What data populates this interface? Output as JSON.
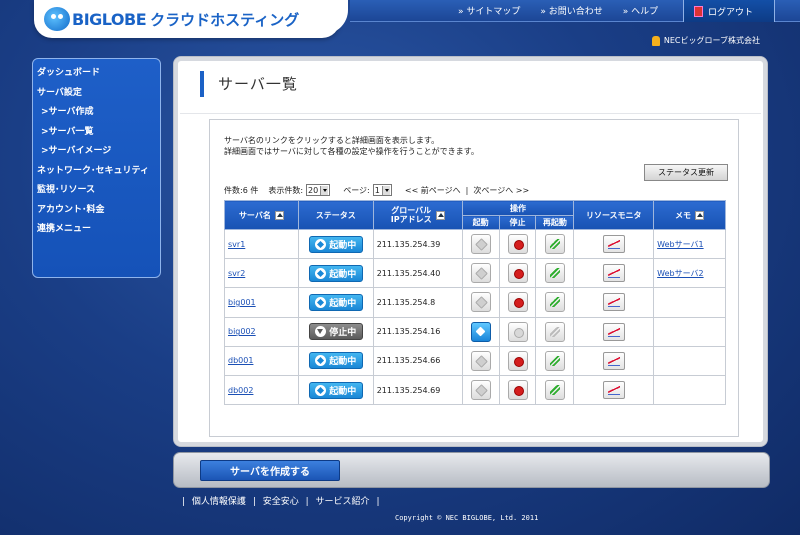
{
  "header": {
    "logo_text": "BIGLOBE",
    "logo_sub": "クラウドホスティング",
    "nav": [
      "サイトマップ",
      "お問い合わせ",
      "ヘルプ"
    ],
    "logout": "ログアウト",
    "corp": "NECビッグローブ株式会社"
  },
  "sidebar": {
    "items": [
      {
        "label": "ダッシュボード"
      },
      {
        "label": "サーバ設定"
      },
      {
        "label": ">サーバ作成"
      },
      {
        "label": ">サーバ一覧"
      },
      {
        "label": ">サーバイメージ"
      },
      {
        "label": "ネットワーク･セキュリティ"
      },
      {
        "label": "監視･リソース"
      },
      {
        "label": "アカウント･料金"
      },
      {
        "label": "連携メニュー"
      }
    ]
  },
  "main": {
    "title": "サーバ一覧",
    "desc1": "サーバ名のリンクをクリックすると詳細画面を表示します。",
    "desc2": "詳細画面ではサーバに対して各種の設定や操作を行うことができます。",
    "status_refresh": "ステータス更新",
    "count_label": "件数:6 件",
    "per_page_label": "表示件数:",
    "per_page_value": "20",
    "page_label": "ページ:",
    "page_value": "1",
    "prev": "<< 前ページへ",
    "sep": "|",
    "next": "次ページへ >>",
    "columns": {
      "name": "サーバ名",
      "status": "ステータス",
      "ip_line1": "グローバル",
      "ip_line2": "IPアドレス",
      "ops": "操作",
      "start": "起動",
      "stop": "停止",
      "restart": "再起動",
      "monitor": "リソースモニタ",
      "memo": "メモ"
    },
    "rows": [
      {
        "name": "svr1",
        "status": "起動中",
        "ip": "211.135.254.39",
        "memo": "Webサーバ1"
      },
      {
        "name": "svr2",
        "status": "起動中",
        "ip": "211.135.254.40",
        "memo": "Webサーバ2"
      },
      {
        "name": "big001",
        "status": "起動中",
        "ip": "211.135.254.8",
        "memo": ""
      },
      {
        "name": "big002",
        "status": "停止中",
        "ip": "211.135.254.16",
        "memo": ""
      },
      {
        "name": "db001",
        "status": "起動中",
        "ip": "211.135.254.66",
        "memo": ""
      },
      {
        "name": "db002",
        "status": "起動中",
        "ip": "211.135.254.69",
        "memo": ""
      }
    ]
  },
  "bottom": {
    "create_button": "サーバを作成する",
    "footer_links": [
      "個人情報保護",
      "安全安心",
      "サービス紹介"
    ],
    "copyright": "Copyright © NEC BIGLOBE, Ltd. 2011"
  }
}
